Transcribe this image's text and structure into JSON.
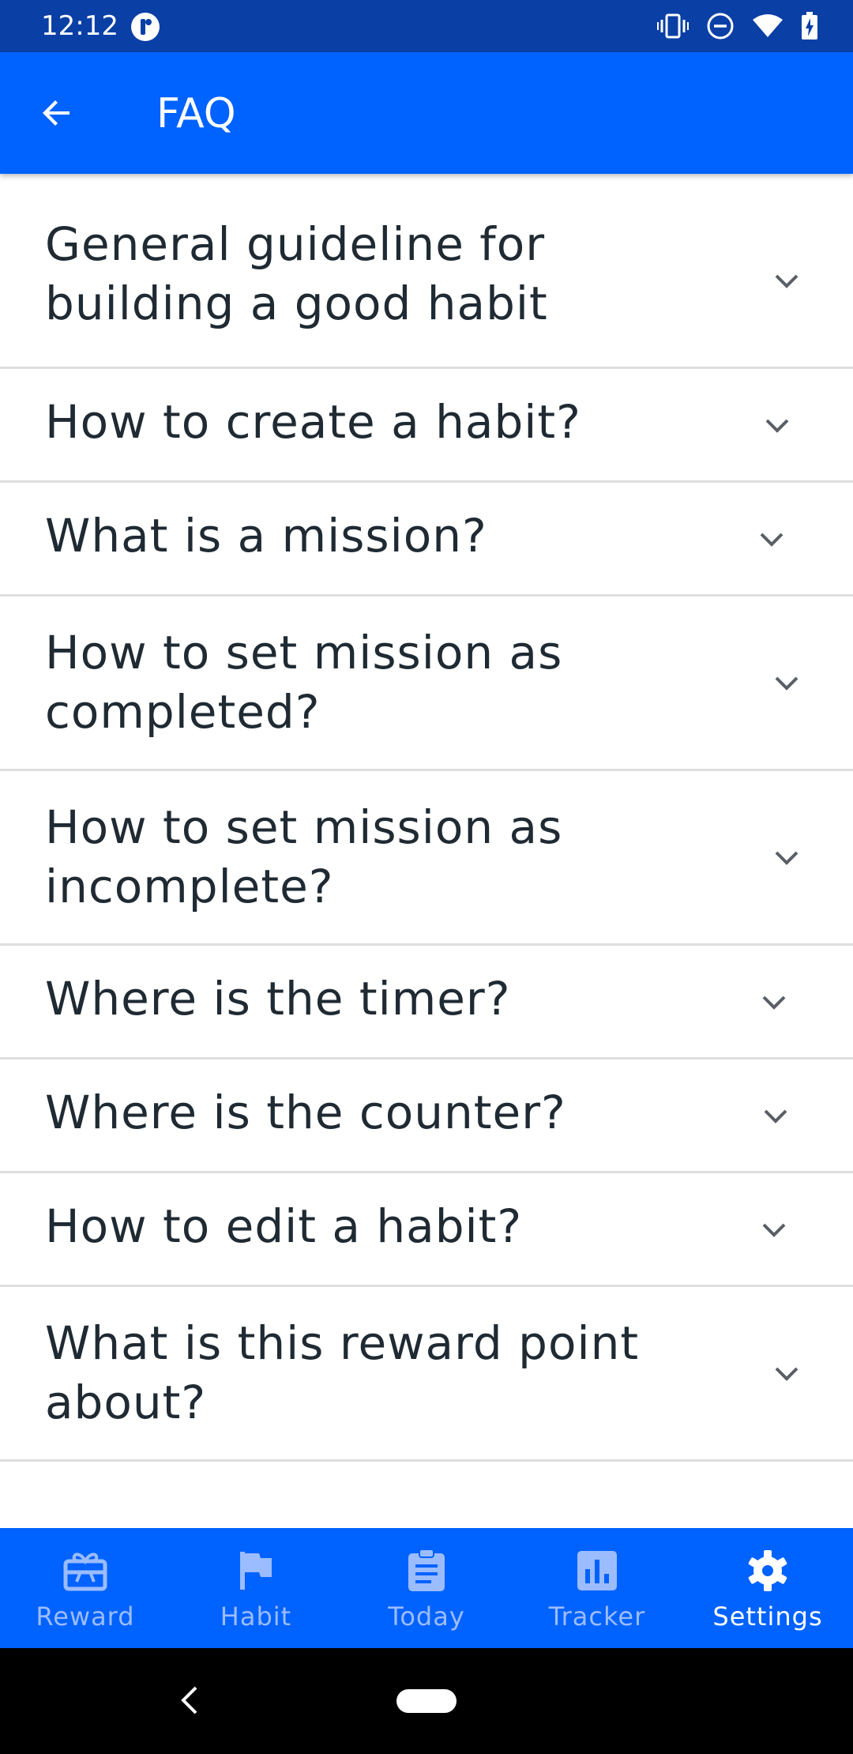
{
  "status_bar": {
    "time": "12:12"
  },
  "app_bar": {
    "title": "FAQ"
  },
  "faq": [
    "General guideline for building a good habit",
    "How to create a habit?",
    "What is a mission?",
    "How to set mission as completed?",
    "How to set mission as incomplete?",
    "Where is the timer?",
    "Where is the counter?",
    "How to edit a habit?",
    "What is this reward point about?"
  ],
  "bottom_nav": [
    {
      "label": "Reward",
      "icon": "reward-icon",
      "active": false
    },
    {
      "label": "Habit",
      "icon": "flag-icon",
      "active": false
    },
    {
      "label": "Today",
      "icon": "clipboard-icon",
      "active": false
    },
    {
      "label": "Tracker",
      "icon": "chart-icon",
      "active": false
    },
    {
      "label": "Settings",
      "icon": "gear-icon",
      "active": true
    }
  ],
  "colors": {
    "status_bar": "#0a3fa5",
    "primary": "#0062ff",
    "nav_inactive": "#9bbcff",
    "text": "#1f2a33",
    "divider": "#dedede"
  }
}
